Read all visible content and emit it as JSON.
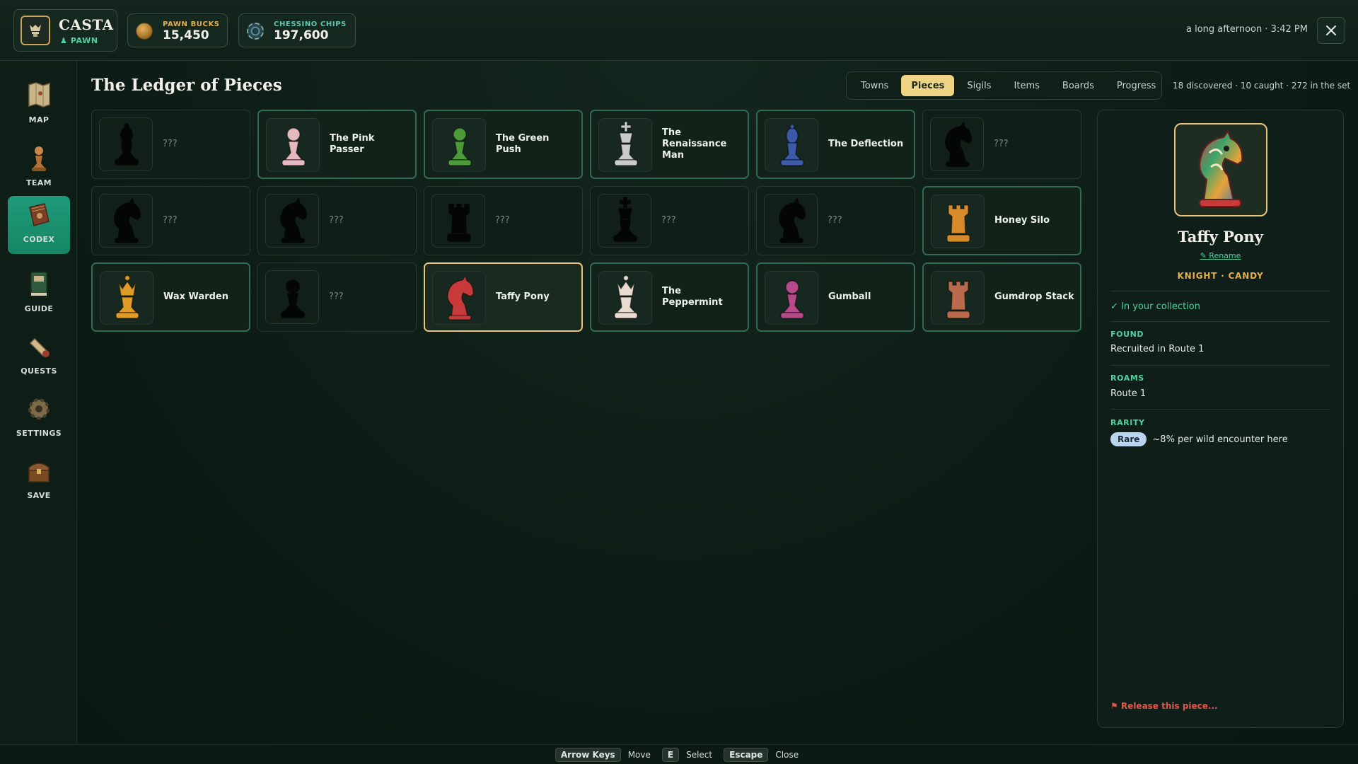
{
  "player": {
    "name": "CASTA",
    "rank": "♟ PAWN"
  },
  "currencies": {
    "bucks": {
      "label": "PAWN BUCKS",
      "value": "15,450",
      "icon": "coin-icon"
    },
    "chips": {
      "label": "CHESSINO CHIPS",
      "value": "197,600",
      "icon": "casino-chip-icon"
    }
  },
  "clock": "a long afternoon · 3:42 PM",
  "sidebar": {
    "items": [
      {
        "label": "MAP",
        "icon": "map-scroll-icon"
      },
      {
        "label": "TEAM",
        "icon": "chess-pawn-icon"
      },
      {
        "label": "CODEX",
        "icon": "book-icon",
        "active": true
      },
      {
        "label": "GUIDE",
        "icon": "guide-book-icon"
      },
      {
        "label": "QUESTS",
        "icon": "quest-scroll-icon"
      },
      {
        "label": "SETTINGS",
        "icon": "gear-icon"
      },
      {
        "label": "SAVE",
        "icon": "treasure-chest-icon"
      }
    ]
  },
  "page": {
    "title": "The Ledger of Pieces"
  },
  "tabs": [
    {
      "label": "Towns"
    },
    {
      "label": "Pieces",
      "active": true
    },
    {
      "label": "Sigils"
    },
    {
      "label": "Items"
    },
    {
      "label": "Boards"
    },
    {
      "label": "Progress"
    }
  ],
  "set_stats": "18 discovered · 10 caught · 272 in the set",
  "pieces": [
    {
      "name": "???",
      "kind": "bishop",
      "state": "unknown"
    },
    {
      "name": "The Pink Passer",
      "kind": "pawn",
      "state": "caught",
      "color": "#e6b8c0"
    },
    {
      "name": "The Green Push",
      "kind": "pawn",
      "state": "caught",
      "color": "#4c9a3a"
    },
    {
      "name": "The Renaissance Man",
      "kind": "king",
      "state": "caught",
      "color": "#c9ccc8"
    },
    {
      "name": "The Deflection",
      "kind": "bishop",
      "state": "caught",
      "color": "#3c5aa8"
    },
    {
      "name": "???",
      "kind": "knight",
      "state": "unknown"
    },
    {
      "name": "???",
      "kind": "knight",
      "state": "unknown"
    },
    {
      "name": "???",
      "kind": "knight",
      "state": "unknown"
    },
    {
      "name": "???",
      "kind": "rook",
      "state": "unknown"
    },
    {
      "name": "???",
      "kind": "king",
      "state": "unknown"
    },
    {
      "name": "???",
      "kind": "knight",
      "state": "unknown"
    },
    {
      "name": "Honey Silo",
      "kind": "rook",
      "state": "caught",
      "color": "#d68a2a"
    },
    {
      "name": "Wax Warden",
      "kind": "queen",
      "state": "caught",
      "color": "#e09a26"
    },
    {
      "name": "???",
      "kind": "pawn",
      "state": "unknown"
    },
    {
      "name": "Taffy Pony",
      "kind": "knight",
      "state": "selected",
      "color": "#c83a3a"
    },
    {
      "name": "The Peppermint",
      "kind": "queen",
      "state": "caught",
      "color": "#e8dcd0"
    },
    {
      "name": "Gumball",
      "kind": "pawn",
      "state": "caught",
      "color": "#b64a8a"
    },
    {
      "name": "Gumdrop Stack",
      "kind": "rook",
      "state": "caught",
      "color": "#b86a4a"
    }
  ],
  "detail": {
    "name": "Taffy Pony",
    "rename": "✎ Rename",
    "class": "KNIGHT · CANDY",
    "collection": "✓ In your collection",
    "found_label": "FOUND",
    "found_value": "Recruited in Route 1",
    "roams_label": "ROAMS",
    "roams_value": "Route 1",
    "rarity_label": "RARITY",
    "rarity_badge": "Rare",
    "rarity_text": "~8% per wild encounter here",
    "release": "⚑ Release this piece..."
  },
  "footer": [
    {
      "key": "Arrow Keys",
      "action": "Move"
    },
    {
      "key": "E",
      "action": "Select"
    },
    {
      "key": "Escape",
      "action": "Close"
    }
  ],
  "colors": {
    "accent": "#4fd1a0",
    "gold": "#e8c57a",
    "selected_tab": "#efd486",
    "danger": "#e0584c"
  }
}
